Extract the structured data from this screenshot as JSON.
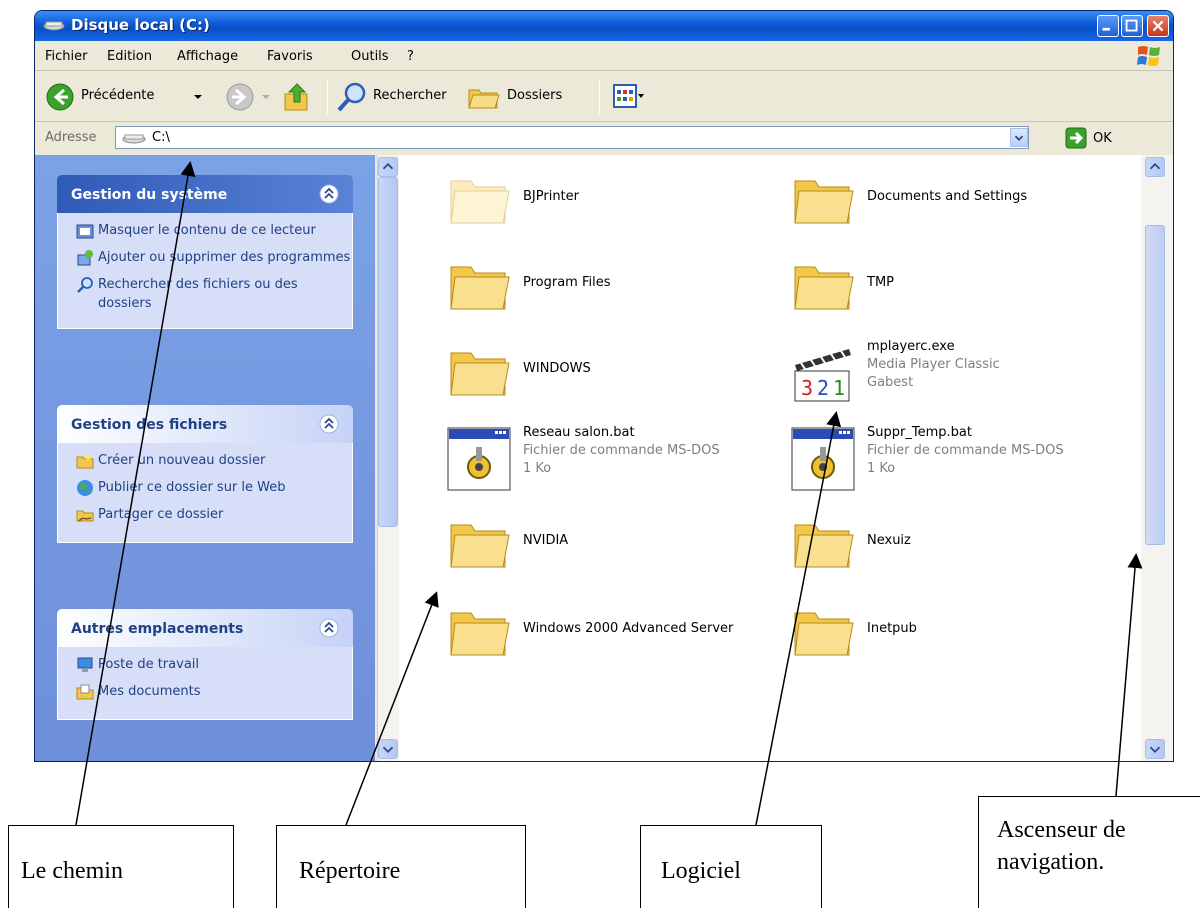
{
  "window": {
    "title": "Disque local (C:)"
  },
  "menu": [
    "Fichier",
    "Edition",
    "Affichage",
    "Favoris",
    "Outils",
    "?"
  ],
  "toolbar": {
    "back_label": "Précédente",
    "search_label": "Rechercher",
    "folders_label": "Dossiers"
  },
  "address": {
    "label": "Adresse",
    "value": "C:\\",
    "go_label": "OK"
  },
  "left_panel": {
    "groups": [
      {
        "title": "Gestion du système",
        "tasks": [
          "Masquer le contenu de ce lecteur",
          "Ajouter ou supprimer des programmes",
          "Rechercher des fichiers ou des dossiers"
        ]
      },
      {
        "title": "Gestion des fichiers",
        "tasks": [
          "Créer un nouveau dossier",
          "Publier ce dossier sur le Web",
          "Partager ce dossier"
        ]
      },
      {
        "title": "Autres emplacements",
        "tasks": [
          "Poste de travail",
          "Mes documents"
        ]
      }
    ]
  },
  "files": [
    {
      "name": "BJPrinter",
      "type": "folder"
    },
    {
      "name": "Documents and Settings",
      "type": "folder"
    },
    {
      "name": "Program Files",
      "type": "folder"
    },
    {
      "name": "TMP",
      "type": "folder"
    },
    {
      "name": "WINDOWS",
      "type": "folder"
    },
    {
      "name": "mplayerc.exe",
      "type": "app",
      "line2": "Media Player Classic",
      "line3": "Gabest"
    },
    {
      "name": "Reseau salon.bat",
      "type": "bat",
      "line2": "Fichier de commande MS-DOS",
      "line3": "1 Ko"
    },
    {
      "name": "Suppr_Temp.bat",
      "type": "bat",
      "line2": "Fichier de commande MS-DOS",
      "line3": "1 Ko"
    },
    {
      "name": "NVIDIA",
      "type": "folder"
    },
    {
      "name": "Nexuiz",
      "type": "folder"
    },
    {
      "name": "Windows 2000 Advanced Server",
      "type": "folder"
    },
    {
      "name": "Inetpub",
      "type": "folder"
    }
  ],
  "callouts": {
    "path": "Le chemin",
    "directory": "Répertoire",
    "software": "Logiciel",
    "scrollbar_line1": "Ascenseur de",
    "scrollbar_line2": "navigation."
  },
  "colors": {
    "titlebar": "#0a58d8",
    "panel": "#6f8fd9",
    "task_text": "#214185",
    "folder": "#f5d77a"
  }
}
